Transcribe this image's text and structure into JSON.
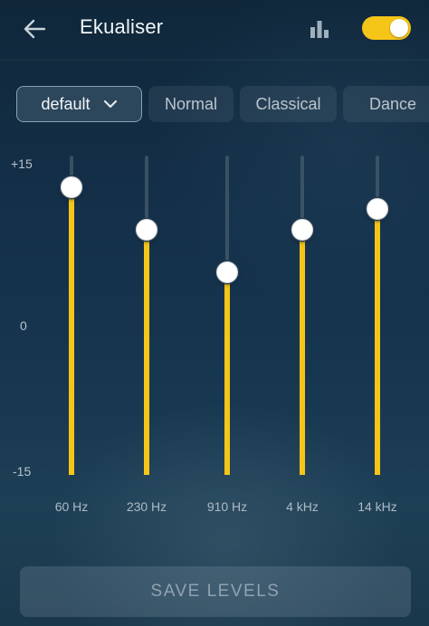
{
  "header": {
    "title": "Ekualiser",
    "back_icon": "arrow-left-icon",
    "visualizer_icon": "bar-chart-icon",
    "enabled": true,
    "accent_color": "#f5c518"
  },
  "presets": {
    "selected": "default",
    "options": [
      "Normal",
      "Classical",
      "Dance"
    ]
  },
  "scale": {
    "max_label": "+15",
    "mid_label": "0",
    "min_label": "-15",
    "min": -15,
    "max": 15
  },
  "bands": [
    {
      "label": "60 Hz",
      "level": 12
    },
    {
      "label": "230 Hz",
      "level": 8
    },
    {
      "label": "910 Hz",
      "level": 4
    },
    {
      "label": "4 kHz",
      "level": 8
    },
    {
      "label": "14 kHz",
      "level": 10
    }
  ],
  "actions": {
    "save_label": "SAVE  LEVELS"
  }
}
